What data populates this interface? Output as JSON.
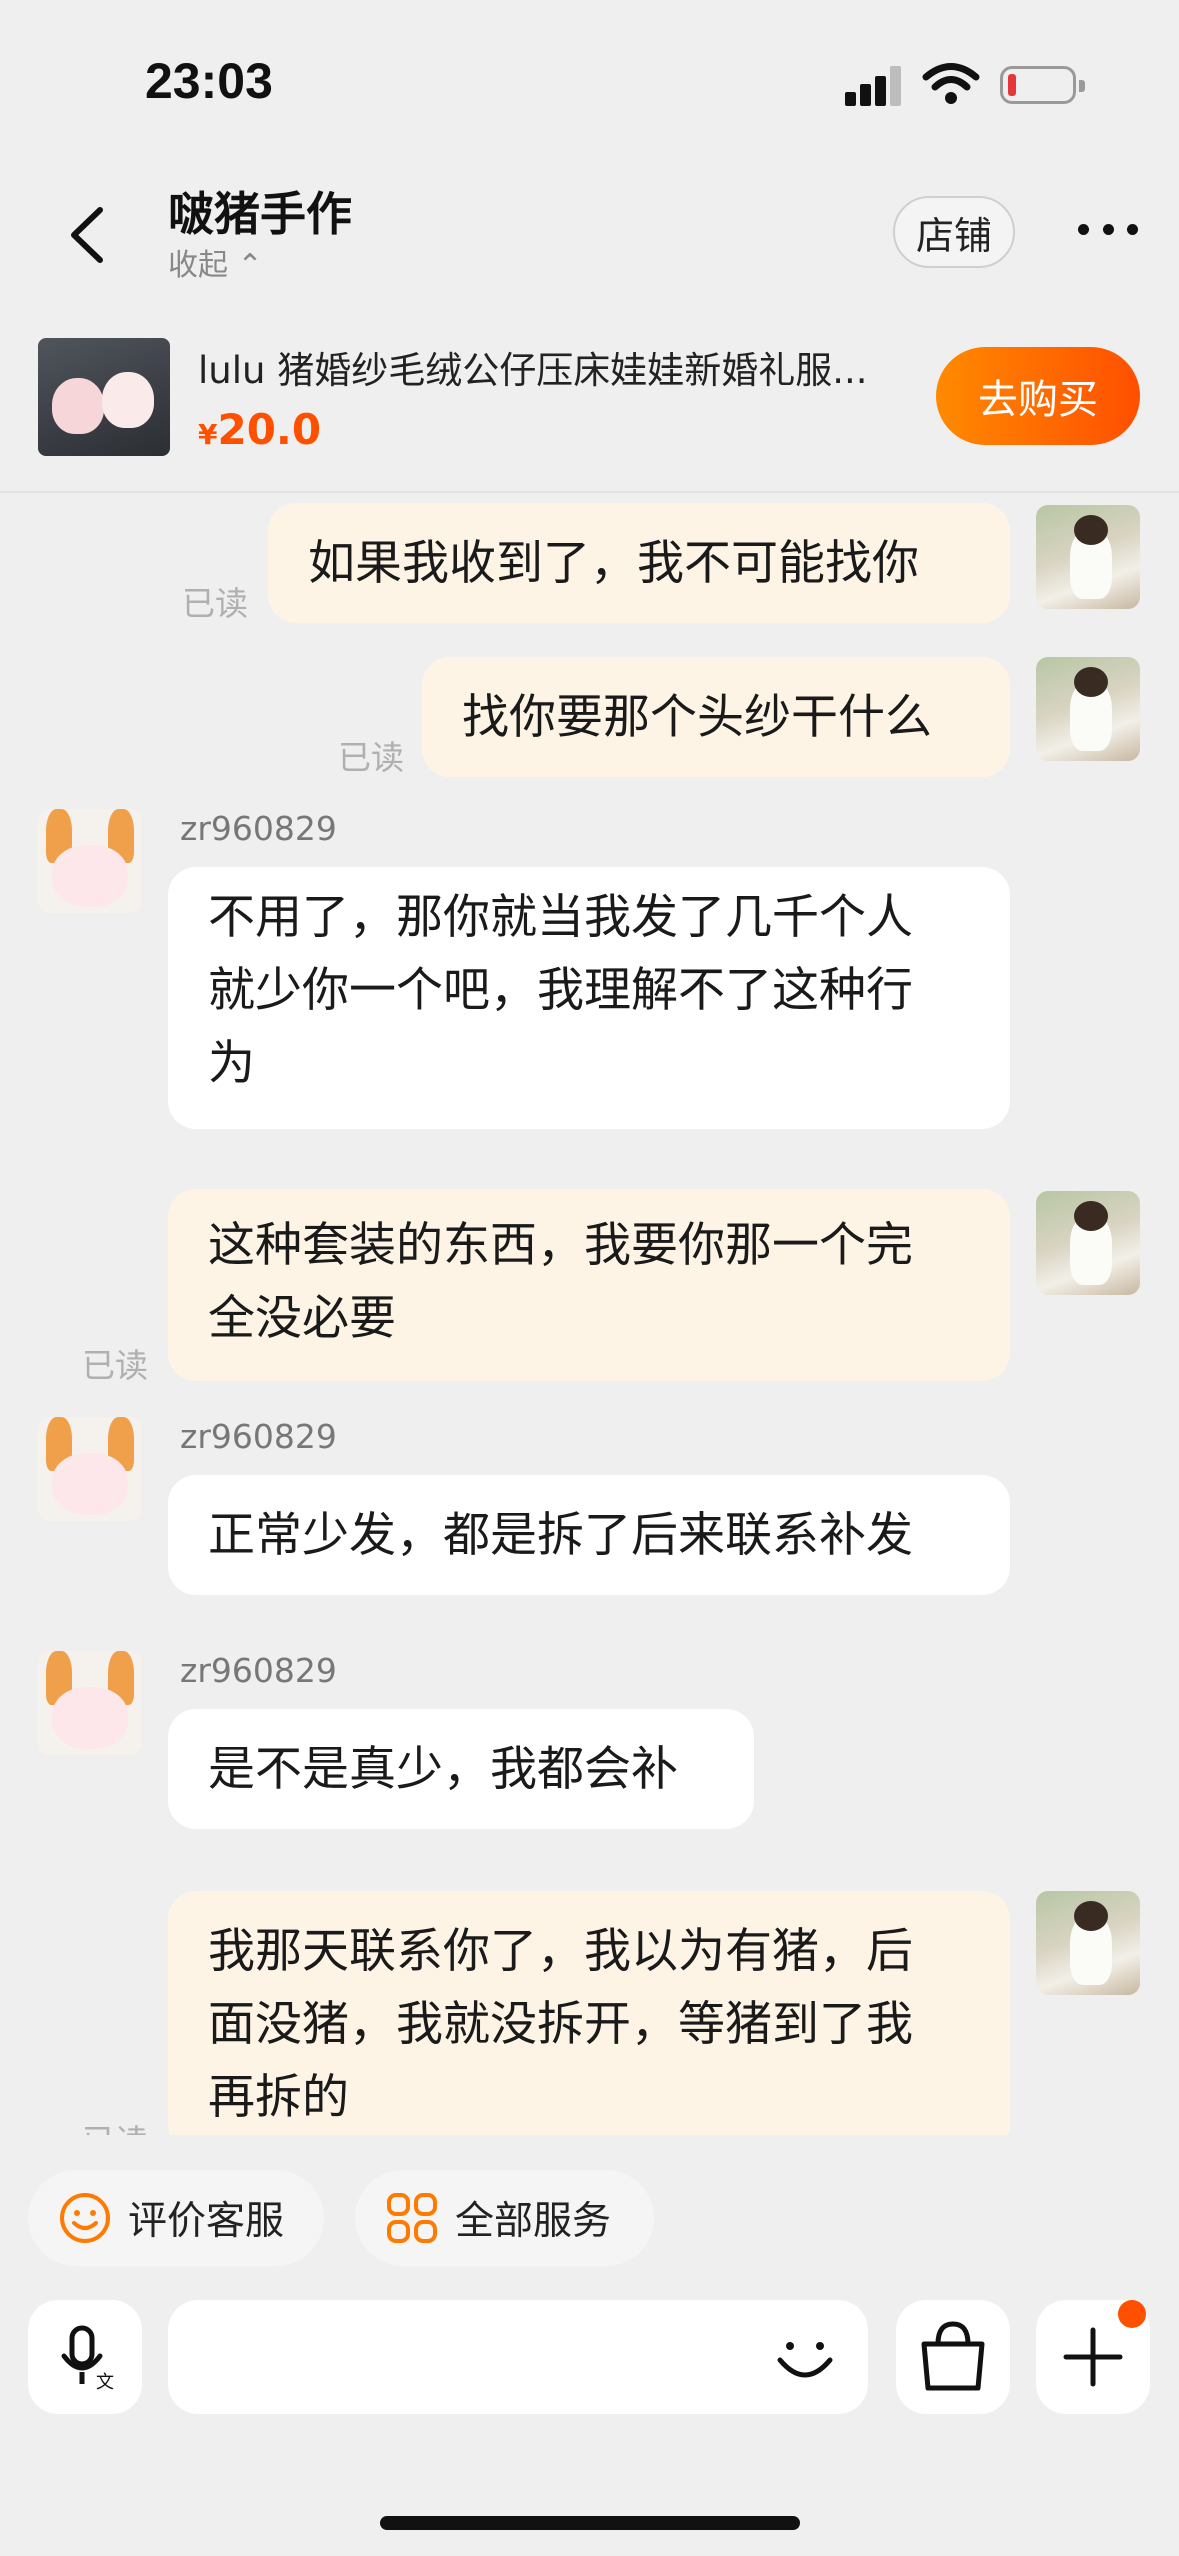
{
  "status_bar": {
    "time": "23:03"
  },
  "header": {
    "shop_name": "啵猪手作",
    "collapse_label": "收起 ⌃",
    "store_button": "店铺"
  },
  "product": {
    "title": "lulu 猪婚纱毛绒公仔压床娃娃新婚礼服...",
    "price_symbol": "¥",
    "price": "20.0",
    "buy_button": "去购买"
  },
  "messages": [
    {
      "from": "me",
      "text": "如果我收到了，我不可能找你",
      "read": "已读"
    },
    {
      "from": "me",
      "text": "找你要那个头纱干什么",
      "read": "已读"
    },
    {
      "from": "them",
      "sender": "zr960829",
      "lines": [
        "不用了，那你就当我发了几千个人",
        "就少你一个吧，我理解不了这种行",
        "为"
      ]
    },
    {
      "from": "me",
      "lines": [
        "这种套装的东西，我要你那一个完",
        "全没必要"
      ],
      "read": "已读"
    },
    {
      "from": "them",
      "sender": "zr960829",
      "text": "正常少发，都是拆了后来联系补发"
    },
    {
      "from": "them",
      "sender": "zr960829",
      "text": "是不是真少，我都会补"
    },
    {
      "from": "me",
      "lines": [
        "我那天联系你了，我以为有猪，后",
        "面没猪，我就没拆开，等猪到了我",
        "再拆的"
      ],
      "read": "已读"
    }
  ],
  "quick_actions": [
    {
      "label": "评价客服",
      "icon": "smiley-icon"
    },
    {
      "label": "全部服务",
      "icon": "grid-icon"
    }
  ],
  "input": {
    "placeholder": ""
  },
  "colors": {
    "accent": "#ff5000",
    "my_bubble": "#fdf4e6",
    "their_bubble": "#ffffff",
    "background": "#efefef"
  }
}
